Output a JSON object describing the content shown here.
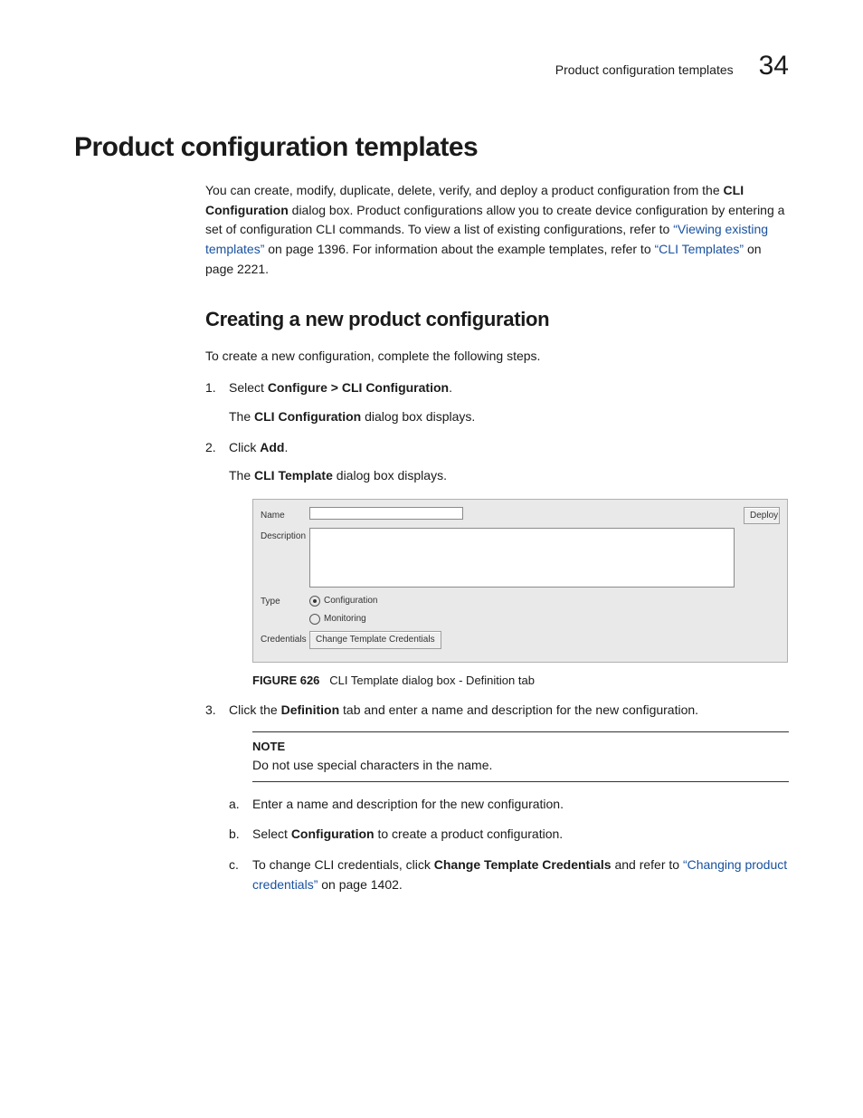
{
  "header": {
    "running_title": "Product configuration templates",
    "chapter_number": "34"
  },
  "h1": "Product configuration templates",
  "intro": {
    "t1": "You can create, modify, duplicate, delete, verify, and deploy a product configuration from the ",
    "b1": "CLI Configuration",
    "t2": " dialog box. Product configurations allow you to create device configuration by entering a set of configuration CLI commands. To view a list of existing configurations, refer to ",
    "link1": "“Viewing existing templates”",
    "t3": " on page 1396. For information about the example templates, refer to ",
    "link2": "“CLI Templates”",
    "t4": " on page 2221."
  },
  "h2": "Creating a new product configuration",
  "lead": "To create a new configuration, complete the following steps.",
  "steps": {
    "s1": {
      "line_a": "Select ",
      "line_b_bold": "Configure > CLI Configuration",
      "line_c": ".",
      "result_a": "The ",
      "result_b_bold": "CLI Configuration",
      "result_c": " dialog box displays."
    },
    "s2": {
      "line_a": "Click ",
      "line_b_bold": "Add",
      "line_c": ".",
      "result_a": "The ",
      "result_b_bold": "CLI Template",
      "result_c": " dialog box displays."
    },
    "s3": {
      "line_a": "Click the ",
      "line_b_bold": "Definition",
      "line_c": " tab and enter a name and description for the new configuration."
    }
  },
  "figure": {
    "labels": {
      "name": "Name",
      "description": "Description",
      "type": "Type",
      "credentials": "Credentials"
    },
    "radios": {
      "configuration": "Configuration",
      "monitoring": "Monitoring"
    },
    "buttons": {
      "change_template_credentials": "Change Template Credentials",
      "deploy": "Deploy"
    },
    "caption_label": "FIGURE 626",
    "caption_text": "CLI Template dialog box - Definition tab"
  },
  "note": {
    "label": "NOTE",
    "text": "Do not use special characters in the name."
  },
  "substeps": {
    "a": "Enter a name and description for the new configuration.",
    "b_a": "Select ",
    "b_bold": "Configuration",
    "b_c": " to create a product configuration.",
    "c_a": "To change CLI credentials, click ",
    "c_bold": "Change Template Credentials",
    "c_b": " and refer to ",
    "c_link": "“Changing product credentials”",
    "c_c": " on page 1402."
  }
}
